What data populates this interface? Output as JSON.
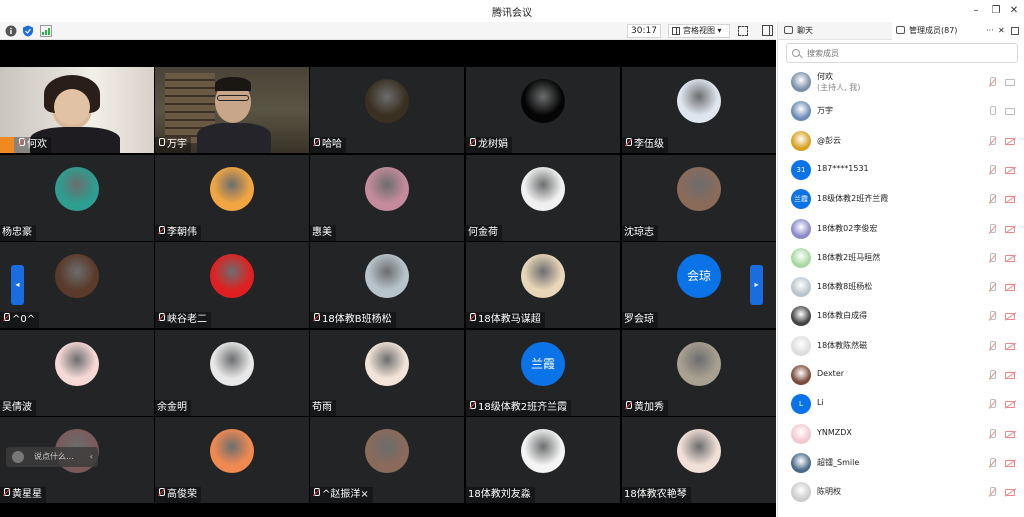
{
  "window": {
    "title": "腾讯会议"
  },
  "toolbar": {
    "timer": "30:17",
    "view_label": "宫格视图"
  },
  "colors": {
    "accent": "#0a73e8",
    "active_speaker": "#2ecc71",
    "muted": "#e84a4a"
  },
  "grid": {
    "rows": [
      [
        {
          "name": "何欢",
          "type": "video",
          "muted": true,
          "host": true
        },
        {
          "name": "万宇",
          "type": "video",
          "muted": false,
          "active": true
        },
        {
          "name": "哈哈",
          "type": "photo",
          "muted": true,
          "bg": "#3a3022"
        },
        {
          "name": "龙树娟",
          "type": "photo",
          "muted": true,
          "bg": "#050505"
        },
        {
          "name": "李伍级",
          "type": "photo",
          "muted": true,
          "bg": "#dfe6ef"
        }
      ],
      [
        {
          "name": "杨忠豪",
          "type": "photo",
          "muted": false,
          "bg": "#2d9e8f"
        },
        {
          "name": "李朝伟",
          "type": "photo",
          "muted": true,
          "bg": "#f2a641"
        },
        {
          "name": "惠美",
          "type": "photo",
          "muted": false,
          "bg": "#c58b9c"
        },
        {
          "name": "何金荷",
          "type": "photo",
          "muted": false,
          "bg": "#f1f1f1"
        },
        {
          "name": "沈琼志",
          "type": "photo",
          "muted": false,
          "bg": "#8a6b5a"
        }
      ],
      [
        {
          "name": "^0^",
          "type": "photo",
          "muted": true,
          "bg": "#5a3a2a"
        },
        {
          "name": "峡谷老二",
          "type": "photo",
          "muted": true,
          "bg": "#e02020"
        },
        {
          "name": "18体教B班杨松",
          "type": "photo",
          "muted": true,
          "bg": "#b8c4cc"
        },
        {
          "name": "18体教马谋超",
          "type": "photo",
          "muted": true,
          "bg": "#e8d6b8"
        },
        {
          "name": "罗会琼",
          "type": "text",
          "avatar_text": "会琼",
          "muted": false
        }
      ],
      [
        {
          "name": "吴倩波",
          "type": "photo",
          "muted": false,
          "bg": "#f6d9d6"
        },
        {
          "name": "余金明",
          "type": "photo",
          "muted": false,
          "bg": "#e8e8e8"
        },
        {
          "name": "苟雨",
          "type": "photo",
          "muted": false,
          "bg": "#f2e4d8"
        },
        {
          "name": "18级体教2班齐兰霞",
          "type": "text",
          "avatar_text": "兰霞",
          "muted": true
        },
        {
          "name": "黄加秀",
          "type": "photo",
          "muted": true,
          "bg": "#a8a090"
        }
      ],
      [
        {
          "name": "黄星星",
          "type": "photo",
          "muted": true,
          "bg": "#7a5a5a"
        },
        {
          "name": "高俊荣",
          "type": "photo",
          "muted": true,
          "bg": "#f08a50"
        },
        {
          "name": "^赵振洋×",
          "type": "photo",
          "muted": true,
          "bg": "#8a6a5a"
        },
        {
          "name": "18体教刘友淼",
          "type": "photo",
          "muted": false,
          "bg": "#f4f4f4"
        },
        {
          "name": "18体教农艳琴",
          "type": "photo",
          "muted": false,
          "bg": "#f2e0d8"
        }
      ]
    ]
  },
  "chat_input": {
    "placeholder": "说点什么..."
  },
  "panel": {
    "tab_chat": "聊天",
    "tab_members": "管理成员(87)",
    "more": "···",
    "search_placeholder": "搜索成员",
    "members": [
      {
        "name": "何欢",
        "sub": "(主持人, 我)",
        "avatar_bg": "#7a8fa8",
        "mic": "muted",
        "cam": "on"
      },
      {
        "name": "万宇",
        "avatar_bg": "#6a8ab8",
        "mic": "on",
        "cam": "on"
      },
      {
        "name": "@彭云",
        "avatar_bg": "#d8a020",
        "mic": "muted",
        "cam": "muted"
      },
      {
        "name": "187****1531",
        "avatar_text": "31",
        "avatar_bg": "#0a73e8",
        "mic": "muted",
        "cam": "muted"
      },
      {
        "name": "18级体教2班齐兰霞",
        "avatar_text": "兰霞",
        "avatar_bg": "#0a73e8",
        "mic": "muted",
        "cam": "muted"
      },
      {
        "name": "18体教02李俊宏",
        "avatar_bg": "#8a8ac8",
        "mic": "muted",
        "cam": "muted"
      },
      {
        "name": "18体教2班马晅然",
        "avatar_bg": "#a8d8a0",
        "mic": "muted",
        "cam": "muted"
      },
      {
        "name": "18体教8班杨松",
        "avatar_bg": "#b8c4cc",
        "mic": "muted",
        "cam": "muted"
      },
      {
        "name": "18体教白成得",
        "avatar_bg": "#444444",
        "mic": "muted",
        "cam": "muted"
      },
      {
        "name": "18体教陈然磁",
        "avatar_bg": "#dddddd",
        "mic": "muted",
        "cam": "muted"
      },
      {
        "name": "Dexter",
        "avatar_bg": "#7a4a3a",
        "mic": "muted",
        "cam": "muted"
      },
      {
        "name": "Li",
        "avatar_text": "L",
        "avatar_bg": "#0a73e8",
        "mic": "muted",
        "cam": "muted"
      },
      {
        "name": "YNMZDX",
        "avatar_bg": "#f2c8d0",
        "mic": "muted",
        "cam": "muted"
      },
      {
        "name": "超镭_Smile",
        "avatar_bg": "#4a6a8a",
        "mic": "muted",
        "cam": "muted"
      },
      {
        "name": "陈明权",
        "avatar_bg": "#cccccc",
        "mic": "muted",
        "cam": "muted"
      }
    ]
  }
}
